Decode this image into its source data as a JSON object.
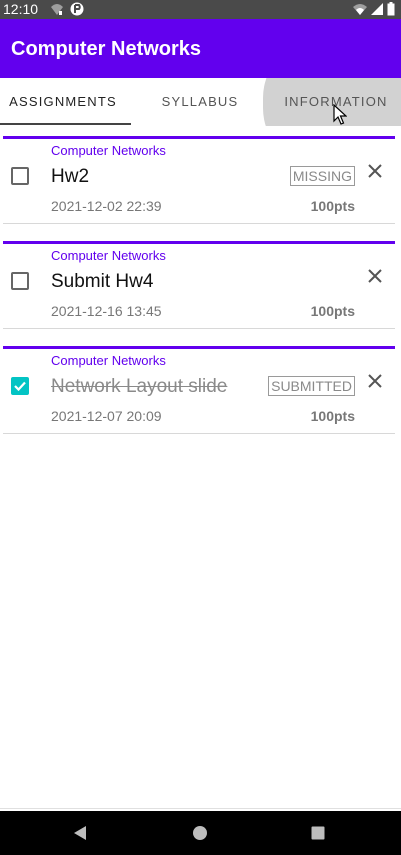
{
  "status_bar": {
    "time": "12:10"
  },
  "app_bar": {
    "title": "Computer Networks"
  },
  "tabs": [
    {
      "label": "ASSIGNMENTS",
      "active": true
    },
    {
      "label": "SYLLABUS",
      "active": false
    },
    {
      "label": "INFORMATION",
      "active": false
    }
  ],
  "assignments": [
    {
      "course": "Computer Networks",
      "title": "Hw2",
      "badge": "MISSING",
      "date": "2021-12-02 22:39",
      "points": "100pts",
      "checked": false
    },
    {
      "course": "Computer Networks",
      "title": "Submit Hw4",
      "badge": "",
      "date": "2021-12-16 13:45",
      "points": "100pts",
      "checked": false
    },
    {
      "course": "Computer Networks",
      "title": "Network Layout slide",
      "badge": "SUBMITTED",
      "date": "2021-12-07 20:09",
      "points": "100pts",
      "checked": true
    }
  ],
  "colors": {
    "primary": "#6200ee",
    "checkbox_checked": "#03c4c4",
    "status_bar": "#4a4a4a"
  },
  "icons": {
    "status_left": [
      "wifi-calling-icon",
      "app-notification-icon"
    ],
    "status_right": [
      "wifi-icon",
      "signal-icon",
      "battery-icon"
    ],
    "card_action": "close-icon",
    "nav": [
      "back-icon",
      "home-icon",
      "recents-icon"
    ]
  }
}
